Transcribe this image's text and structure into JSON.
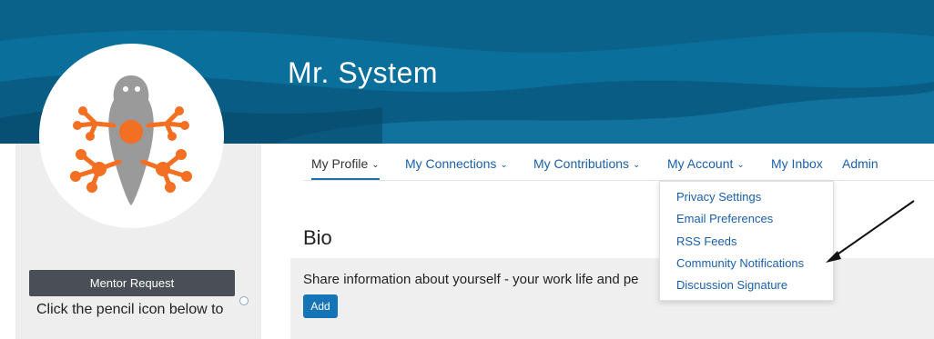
{
  "profile": {
    "name": "Mr. System"
  },
  "nav": {
    "my_profile": "My Profile",
    "my_connections": "My Connections",
    "my_contributions": "My Contributions",
    "my_account": "My Account",
    "my_inbox": "My Inbox",
    "admin": "Admin",
    "chevron": "⌄"
  },
  "account_menu": {
    "items": [
      "Privacy Settings",
      "Email Preferences",
      "RSS Feeds",
      "Community Notifications",
      "Discussion Signature"
    ]
  },
  "bio": {
    "title": "Bio",
    "prompt": "Share information about yourself - your work life and pe",
    "add_label": "Add"
  },
  "sidebar": {
    "mentor_button": "Mentor Request",
    "pencil_note": "Click the pencil icon below to"
  },
  "colors": {
    "banner": "#0b6f9c",
    "link": "#1a5fa8",
    "add_button": "#1474b5",
    "avatar_orange": "#f36f21",
    "avatar_gray": "#9a9a9a"
  },
  "icons": [
    "frog-avatar-icon",
    "chevron-down-icon",
    "annotation-arrow-icon"
  ]
}
